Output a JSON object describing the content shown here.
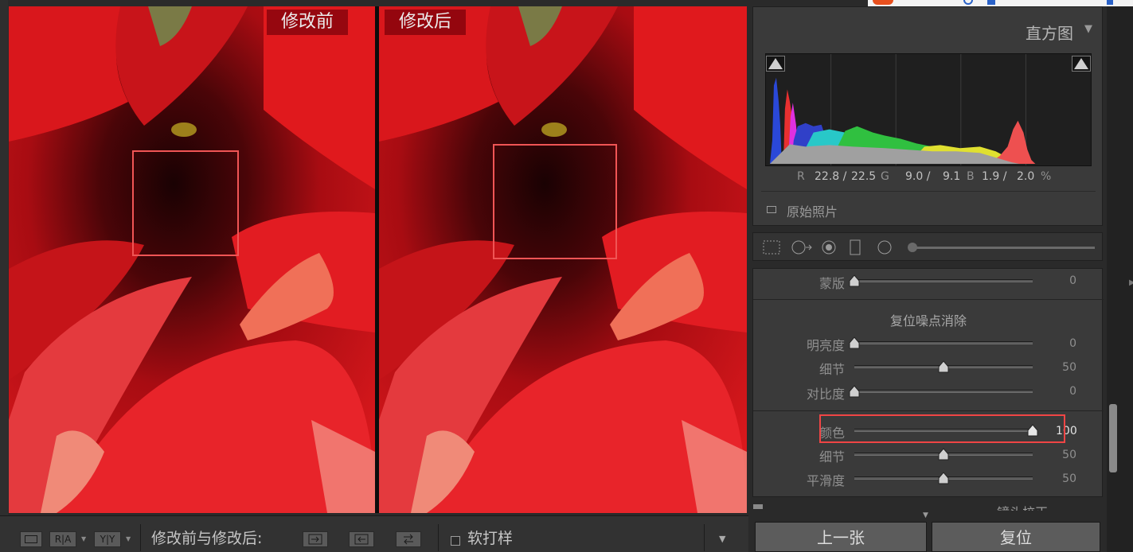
{
  "viewer": {
    "before_label": "修改前",
    "after_label": "修改后"
  },
  "toolbar": {
    "view_icon": "loupe-view-icon",
    "ra_label": "R|A",
    "yy_label": "Y|Y",
    "compare_label": "修改前与修改后:",
    "soft_proof_label": "软打样",
    "soft_proof_checked": false,
    "menu_icon": "caret-down-icon"
  },
  "histogram": {
    "title": "直方图",
    "readout": {
      "r_label": "R",
      "r_before": "22.8 /",
      "r_after": "22.5",
      "g_label": "G",
      "g_before": "9.0 /",
      "g_after": "9.1",
      "b_label": "B",
      "b_before": "1.9 /",
      "b_after": "2.0",
      "unit": "%"
    },
    "original_photo_label": "原始照片",
    "original_photo_checked": false
  },
  "detail": {
    "mask": {
      "label": "蒙版",
      "value": "0",
      "fraction": 0
    },
    "luminance_title": "复位噪点消除",
    "luminance": [
      {
        "label": "明亮度",
        "value": "0",
        "fraction": 0
      },
      {
        "label": "细节",
        "value": "50",
        "fraction": 0.5
      },
      {
        "label": "对比度",
        "value": "0",
        "fraction": 0
      }
    ],
    "color": [
      {
        "label": "颜色",
        "value": "100",
        "fraction": 1
      },
      {
        "label": "细节",
        "value": "50",
        "fraction": 0.5
      },
      {
        "label": "平滑度",
        "value": "50",
        "fraction": 0.5
      }
    ]
  },
  "next_panel_label": "镜头校正",
  "buttons": {
    "previous": "上一张",
    "reset": "复位"
  },
  "colors": {
    "highlight": "#f04545",
    "petal_red": "#d8141a"
  }
}
